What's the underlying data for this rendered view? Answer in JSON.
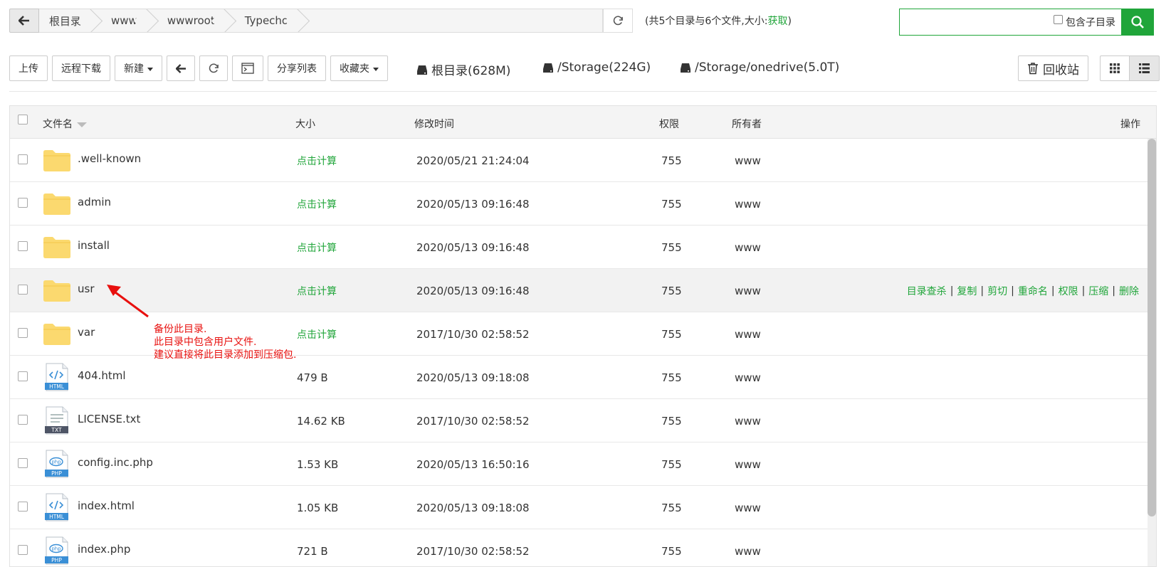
{
  "pathbar": {
    "crumbs": [
      "根目录",
      "www",
      "wwwroot",
      "Typecho"
    ]
  },
  "summary": {
    "text": "(共5个目录与6个文件,大小:",
    "link": "获取",
    "close": ")"
  },
  "search": {
    "placeholder": "",
    "subdir_label": "包含子目录"
  },
  "toolbar": {
    "upload": "上传",
    "remote_download": "远程下载",
    "new": "新建",
    "share_list": "分享列表",
    "favorites": "收藏夹"
  },
  "disks": [
    "根目录(628M)",
    "/Storage(224G)",
    "/Storage/onedrive(5.0T)"
  ],
  "recycle": "回收站",
  "table": {
    "headers": {
      "name": "文件名",
      "size": "大小",
      "mtime": "修改时间",
      "perm": "权限",
      "owner": "所有者",
      "ops": "操作"
    },
    "rows": [
      {
        "name": ".well-known",
        "type": "folder",
        "size": "点击计算",
        "mtime": "2020/05/21 21:24:04",
        "perm": "755",
        "owner": "www"
      },
      {
        "name": "admin",
        "type": "folder",
        "size": "点击计算",
        "mtime": "2020/05/13 09:16:48",
        "perm": "755",
        "owner": "www"
      },
      {
        "name": "install",
        "type": "folder",
        "size": "点击计算",
        "mtime": "2020/05/13 09:16:48",
        "perm": "755",
        "owner": "www"
      },
      {
        "name": "usr",
        "type": "folder",
        "size": "点击计算",
        "mtime": "2020/05/13 09:16:48",
        "perm": "755",
        "owner": "www"
      },
      {
        "name": "var",
        "type": "folder",
        "size": "点击计算",
        "mtime": "2017/10/30 02:58:52",
        "perm": "755",
        "owner": "www"
      },
      {
        "name": "404.html",
        "type": "html",
        "size": "479 B",
        "mtime": "2020/05/13 09:18:08",
        "perm": "755",
        "owner": "www"
      },
      {
        "name": "LICENSE.txt",
        "type": "txt",
        "size": "14.62 KB",
        "mtime": "2017/10/30 02:58:52",
        "perm": "755",
        "owner": "www"
      },
      {
        "name": "config.inc.php",
        "type": "php",
        "size": "1.53 KB",
        "mtime": "2020/05/13 16:50:16",
        "perm": "755",
        "owner": "www"
      },
      {
        "name": "index.html",
        "type": "html",
        "size": "1.05 KB",
        "mtime": "2020/05/13 09:18:08",
        "perm": "755",
        "owner": "www"
      },
      {
        "name": "index.php",
        "type": "php",
        "size": "721 B",
        "mtime": "2017/10/30 02:58:52",
        "perm": "755",
        "owner": "www"
      }
    ],
    "hover_ops": [
      "目录查杀",
      "复制",
      "剪切",
      "重命名",
      "权限",
      "压缩",
      "删除"
    ]
  },
  "icon_labels": {
    "html": "HTML",
    "txt": "TXT",
    "php": "PHP"
  },
  "annotation": {
    "lines": [
      "备份此目录.",
      "此目录中包含用户文件.",
      "建议直接将此目录添加到压缩包."
    ]
  },
  "colors": {
    "accent": "#20a53a",
    "annotation": "#e8100e",
    "folder": "#fbd96f"
  }
}
